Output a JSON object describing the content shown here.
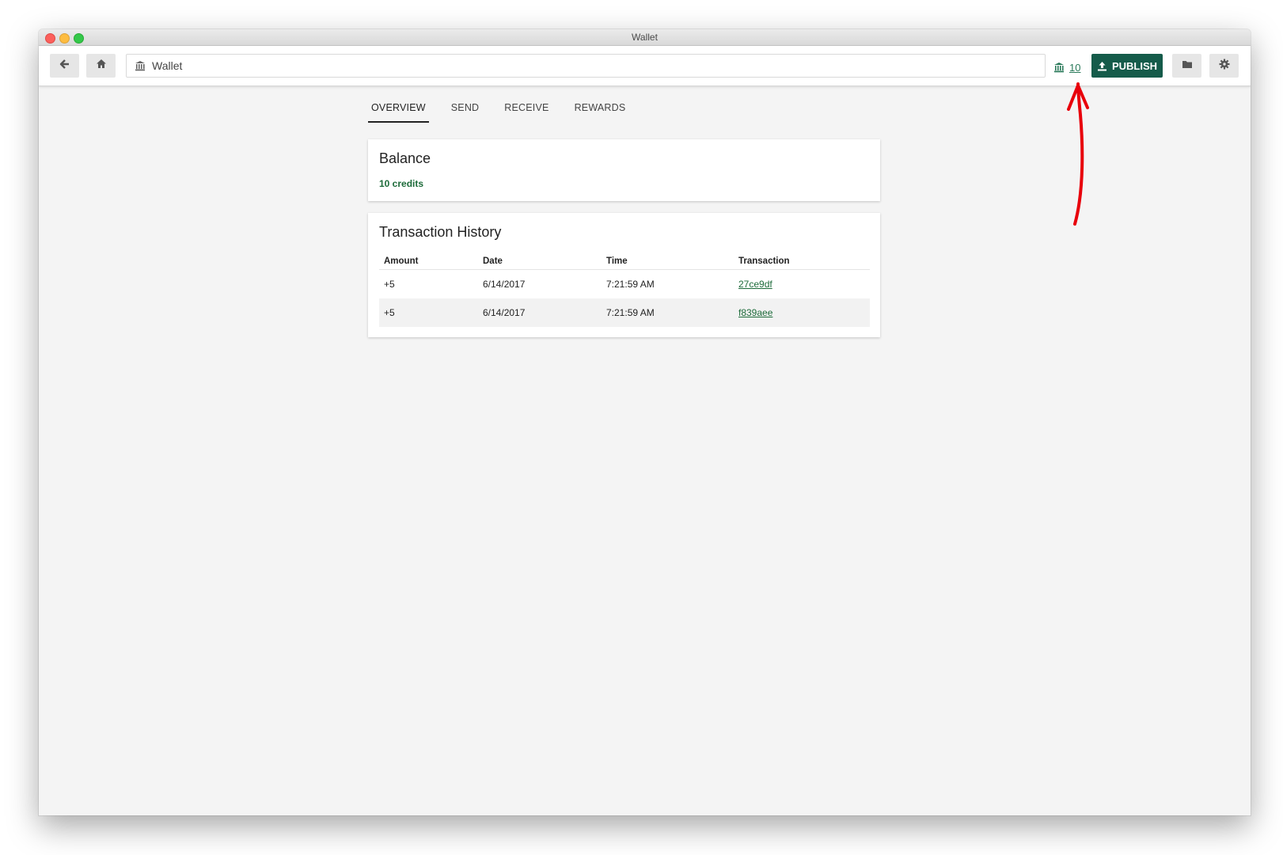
{
  "window": {
    "title": "Wallet"
  },
  "toolbar": {
    "address_text": "Wallet",
    "balance_count": "10",
    "publish_label": "PUBLISH"
  },
  "tabs": [
    "OVERVIEW",
    "SEND",
    "RECEIVE",
    "REWARDS"
  ],
  "balance": {
    "title": "Balance",
    "credits": "10 credits"
  },
  "history": {
    "title": "Transaction History",
    "headers": [
      "Amount",
      "Date",
      "Time",
      "Transaction"
    ],
    "rows": [
      {
        "amount": "+5",
        "date": "6/14/2017",
        "time": "7:21:59 AM",
        "txid": "27ce9df"
      },
      {
        "amount": "+5",
        "date": "6/14/2017",
        "time": "7:21:59 AM",
        "txid": "f839aee"
      }
    ]
  },
  "colors": {
    "accent": "#155b4a",
    "credits_green": "#1d6b3a",
    "annotation_red": "#e8000b"
  },
  "icons": {
    "back": "arrow-left-icon",
    "home": "home-icon",
    "address": "bank-icon",
    "balance": "bank-icon",
    "publish": "upload-icon",
    "folder": "folder-icon",
    "settings": "gear-icon"
  }
}
